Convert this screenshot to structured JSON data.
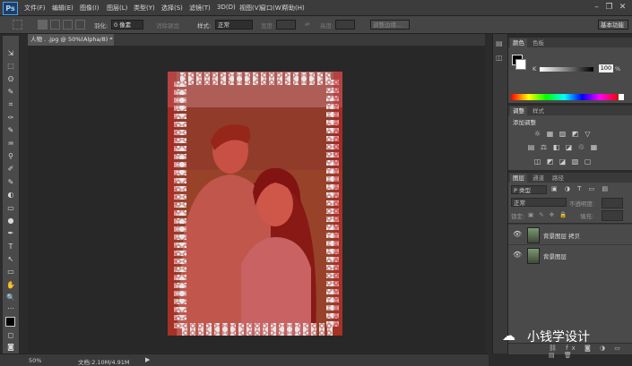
{
  "app": {
    "logo": "Ps"
  },
  "menu": [
    {
      "label": "文件(F)"
    },
    {
      "label": "编辑(E)"
    },
    {
      "label": "图像(I)"
    },
    {
      "label": "图层(L)"
    },
    {
      "label": "类型(Y)"
    },
    {
      "label": "选择(S)"
    },
    {
      "label": "滤镜(T)"
    },
    {
      "label": "3D(D)"
    },
    {
      "label": "视图(V)"
    },
    {
      "label": "窗口(W)"
    },
    {
      "label": "帮助(H)"
    }
  ],
  "window_controls": {
    "minimize": "–",
    "restore": "❐",
    "close": "✕"
  },
  "options": {
    "feather_label": "羽化:",
    "feather_value": "0 像素",
    "antialias_label": "消除锯齿",
    "style_label": "样式:",
    "style_value": "正常",
    "width_label": "宽度:",
    "height_label": "高度:",
    "refine_edge": "调整边缘...",
    "workspace": "基本功能"
  },
  "document": {
    "tab_title": "人物 . .jpg @ 50%(Alpha/8) *",
    "tab_close": "×",
    "zoom": "50%",
    "doc_info": "文档:2.10M/4.91M"
  },
  "tools": [
    "⇲",
    "⬚",
    "ʘ",
    "✎",
    "⌗",
    "✑",
    "✎",
    "♒",
    "⚲",
    "✐",
    "✎",
    "◐",
    "▭",
    "●",
    "◎",
    "✒",
    "T",
    "↖",
    "▭",
    "✋",
    "🔍",
    "⋯",
    "◼",
    "◻",
    "◙"
  ],
  "color_panel": {
    "tabs": [
      "颜色",
      "色板"
    ],
    "channel": "K",
    "value": "100",
    "percent": "%"
  },
  "adjustments_panel": {
    "tabs": [
      "调整",
      "样式"
    ],
    "title": "添加调整",
    "icons_row1": [
      "☼",
      "▦",
      "▨",
      "◩",
      "▽"
    ],
    "icons_row2": [
      "▤",
      "⚖",
      "◧",
      "◪",
      "♲",
      "▦"
    ],
    "icons_row3": [
      "◫",
      "◩",
      "◪",
      "▧",
      "▢"
    ]
  },
  "layers_panel": {
    "tabs": [
      "图层",
      "通道",
      "路径"
    ],
    "filter": "P 类型",
    "blend_mode": "正常",
    "opacity_label": "不透明度:",
    "lock_label": "锁定:",
    "fill_label": "填充:",
    "layers": [
      {
        "name": "背景图层 拷贝"
      },
      {
        "name": "背景图层"
      }
    ]
  },
  "watermark": {
    "text": "小钱学设计"
  }
}
